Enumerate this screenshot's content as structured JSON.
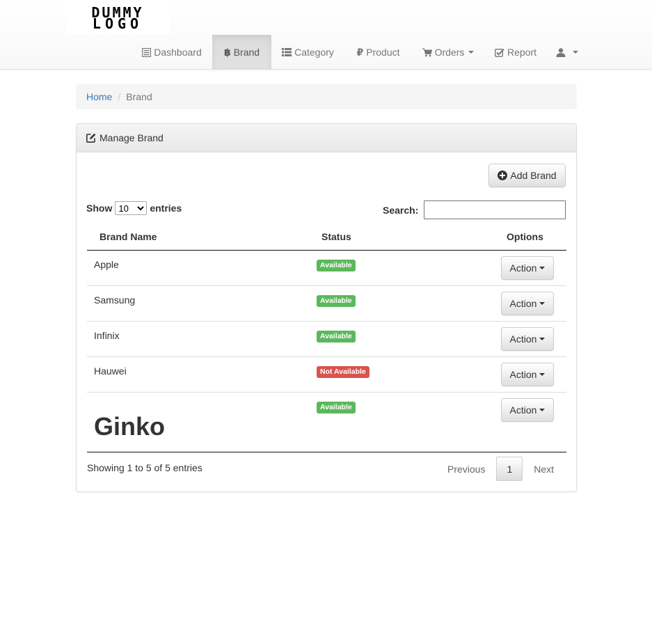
{
  "logo": {
    "line1": "DUMMY",
    "line2": "LOGO"
  },
  "nav": {
    "items": [
      {
        "label": "Dashboard",
        "icon": "list-alt-icon",
        "active": false
      },
      {
        "label": "Brand",
        "icon": "bitcoin-icon",
        "active": true
      },
      {
        "label": "Category",
        "icon": "th-list-icon",
        "active": false
      },
      {
        "label": "Product",
        "icon": "ruble-icon",
        "active": false
      },
      {
        "label": "Orders",
        "icon": "shopping-cart-icon",
        "active": false
      },
      {
        "label": "Report",
        "icon": "check-icon",
        "active": false
      },
      {
        "label": "",
        "icon": "user-icon",
        "active": false
      }
    ]
  },
  "breadcrumb": {
    "home": "Home",
    "separator": "/",
    "current": "Brand"
  },
  "panel": {
    "title": "Manage Brand",
    "add_button": "Add Brand"
  },
  "table_controls": {
    "show_label": "Show",
    "entries_label": "entries",
    "page_length": "10",
    "search_label": "Search:",
    "search_value": ""
  },
  "table": {
    "headers": [
      "Brand Name",
      "Status",
      "Options"
    ],
    "rows": [
      {
        "name": "Apple",
        "status": "Available",
        "action": "Action"
      },
      {
        "name": "Samsung",
        "status": "Available",
        "action": "Action"
      },
      {
        "name": "Infinix",
        "status": "Available",
        "action": "Action"
      },
      {
        "name": "Hauwei",
        "status": "Not Available",
        "action": "Action"
      },
      {
        "name": "Ginko",
        "status": "Available",
        "action": "Action"
      }
    ]
  },
  "footer": {
    "info": "Showing 1 to 5 of 5 entries",
    "previous": "Previous",
    "page": "1",
    "next": "Next"
  },
  "colors": {
    "available": "#5cb85c",
    "not_available": "#d9534f",
    "link": "#337ab7"
  }
}
